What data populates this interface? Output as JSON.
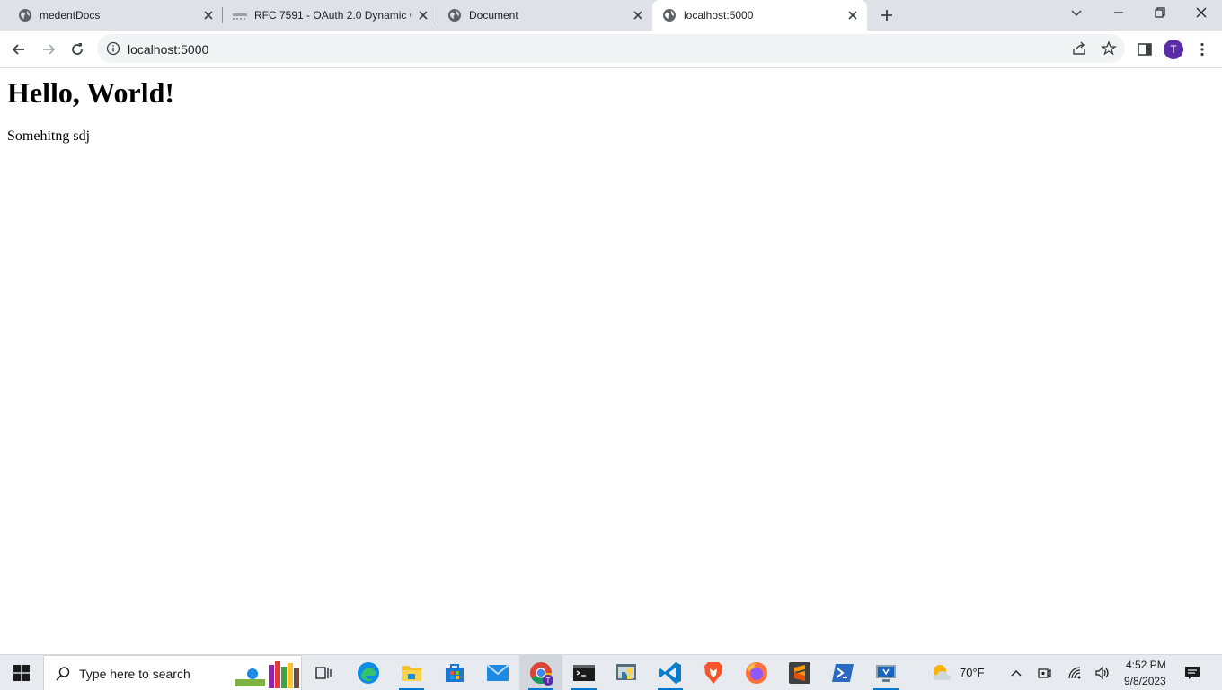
{
  "browser": {
    "tabs": [
      {
        "title": "medentDocs",
        "active": false
      },
      {
        "title": "RFC 7591 - OAuth 2.0 Dynamic C",
        "active": false
      },
      {
        "title": "Document",
        "active": false
      },
      {
        "title": "localhost:5000",
        "active": true
      }
    ],
    "address": "localhost:5000",
    "profile_initial": "T"
  },
  "page": {
    "heading": "Hello, World!",
    "paragraph": "Somehitng sdj"
  },
  "taskbar": {
    "search_placeholder": "Type here to search",
    "weather": "70°F",
    "time": "4:52 PM",
    "date": "9/8/2023"
  },
  "colors": {
    "tabstrip": "#dee1e6",
    "omnibox": "#f1f3f4",
    "avatar": "#5b2ca8",
    "taskbar": "#e7eaef",
    "accent": "#0078d4"
  }
}
